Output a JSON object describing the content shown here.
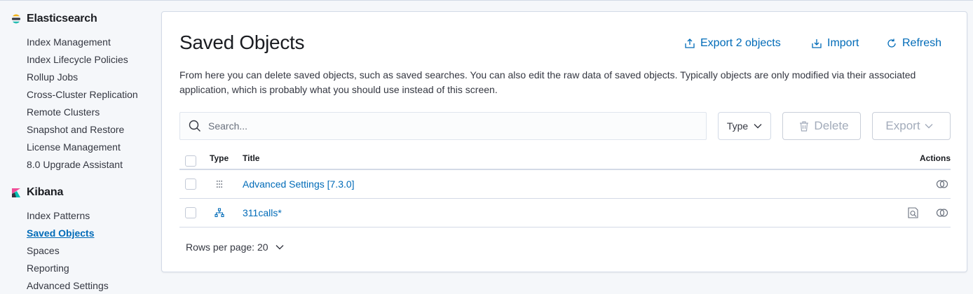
{
  "sidebar": {
    "elasticsearch": {
      "title": "Elasticsearch",
      "items": [
        {
          "label": "Index Management"
        },
        {
          "label": "Index Lifecycle Policies"
        },
        {
          "label": "Rollup Jobs"
        },
        {
          "label": "Cross-Cluster Replication"
        },
        {
          "label": "Remote Clusters"
        },
        {
          "label": "Snapshot and Restore"
        },
        {
          "label": "License Management"
        },
        {
          "label": "8.0 Upgrade Assistant"
        }
      ]
    },
    "kibana": {
      "title": "Kibana",
      "items": [
        {
          "label": "Index Patterns"
        },
        {
          "label": "Saved Objects",
          "active": true
        },
        {
          "label": "Spaces"
        },
        {
          "label": "Reporting"
        },
        {
          "label": "Advanced Settings"
        }
      ]
    }
  },
  "main": {
    "title": "Saved Objects",
    "actions": {
      "export": "Export 2 objects",
      "import": "Import",
      "refresh": "Refresh"
    },
    "description": "From here you can delete saved objects, such as saved searches. You can also edit the raw data of saved objects. Typically objects are only modified via their associated application, which is probably what you should use instead of this screen.",
    "search_placeholder": "Search...",
    "type_filter": "Type",
    "delete_label": "Delete",
    "export_label": "Export",
    "table": {
      "headers": {
        "type": "Type",
        "title": "Title",
        "actions": "Actions"
      },
      "rows": [
        {
          "type_icon": "advanced-settings-icon",
          "title": "Advanced Settings [7.3.0]",
          "actions": [
            "relationships-icon"
          ]
        },
        {
          "type_icon": "index-pattern-icon",
          "title": "311calls*",
          "actions": [
            "inspect-icon",
            "relationships-icon"
          ]
        }
      ]
    },
    "rows_per_page": "Rows per page: 20"
  },
  "colors": {
    "link": "#006bb8",
    "text": "#343741",
    "border": "#d3dae6",
    "background": "#f5f7fa"
  }
}
